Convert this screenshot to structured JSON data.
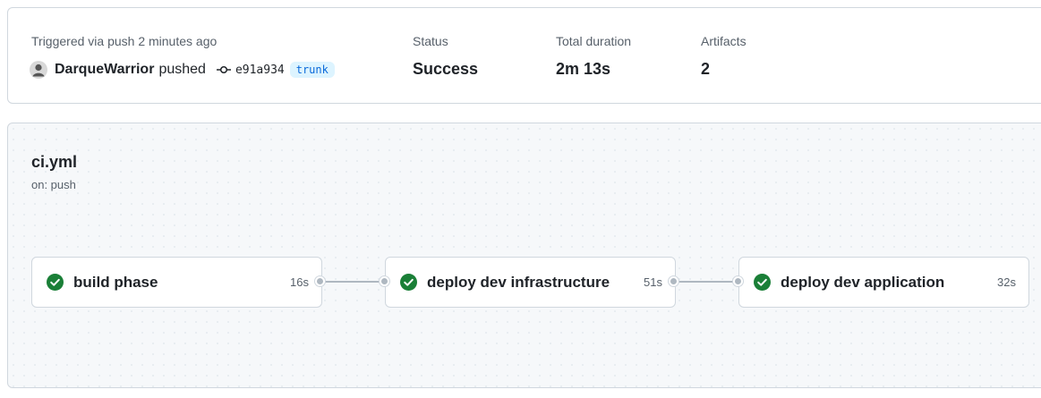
{
  "summary": {
    "trigger_text": "Triggered via push 2 minutes ago",
    "actor": "DarqueWarrior",
    "action": "pushed",
    "commit_sha": "e91a934",
    "branch": "trunk",
    "status_label": "Status",
    "status_value": "Success",
    "duration_label": "Total duration",
    "duration_value": "2m 13s",
    "artifacts_label": "Artifacts",
    "artifacts_value": "2"
  },
  "workflow": {
    "name": "ci.yml",
    "trigger": "on: push",
    "jobs": [
      {
        "name": "build phase",
        "duration": "16s",
        "status": "success"
      },
      {
        "name": "deploy dev infrastructure",
        "duration": "51s",
        "status": "success"
      },
      {
        "name": "deploy dev application",
        "duration": "32s",
        "status": "success"
      }
    ]
  },
  "colors": {
    "success": "#1a7f37",
    "branch_bg": "#ddf4ff",
    "branch_text": "#0969da",
    "connector": "#afb8c1"
  },
  "icons": {
    "avatar": "user-avatar",
    "commit": "git-commit-icon",
    "job_status": "check-circle-icon"
  }
}
